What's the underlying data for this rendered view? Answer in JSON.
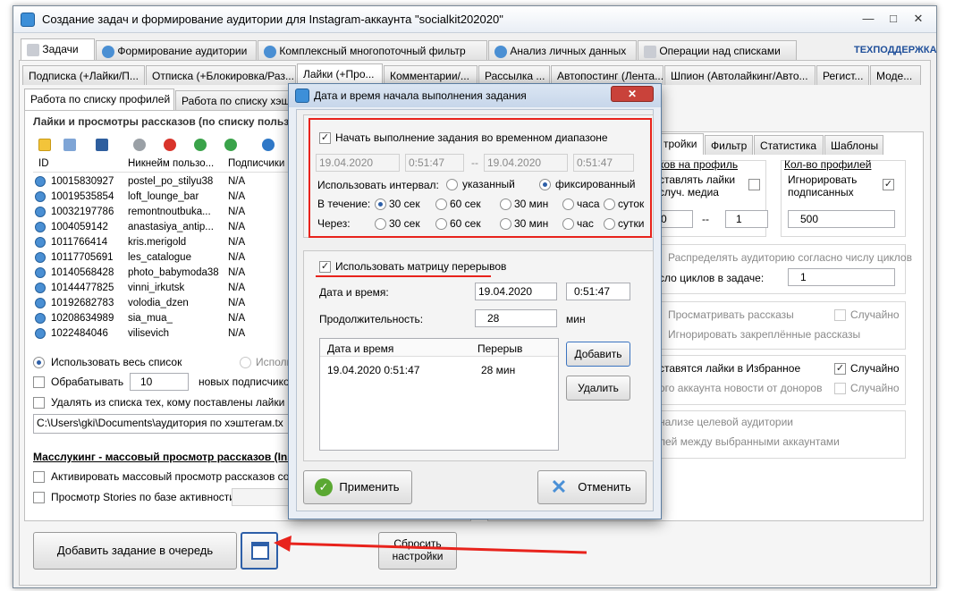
{
  "window": {
    "title": "Создание задач и формирование аудитории для Instagram-аккаунта \"socialkit202020\"",
    "controls": [
      "—",
      "□",
      "✕"
    ]
  },
  "main_tabs": [
    "Задачи",
    "Формирование аудитории",
    "Комплексный многопоточный фильтр",
    "Анализ личных данных",
    "Операции над списками"
  ],
  "support_link": "ТЕХПОДДЕРЖКА",
  "sub_tabs": [
    "Подписка (+Лайки/П...",
    "Отписка (+Блокировка/Раз...",
    "Лайки (+Про...",
    "Комментарии/...",
    "Рассылка ...",
    "Автопостинг (Лента...",
    "Шпион (Автолайкинг/Авто...",
    "Регист...",
    "Моде..."
  ],
  "list_tabs": [
    "Работа по списку профилей",
    "Работа по списку хэштегов"
  ],
  "left": {
    "section_title": "Лайки и просмотры рассказов (по списку пользователей)",
    "columns": [
      "ID",
      "Никнейм пользо...",
      "Подписчики"
    ],
    "rows": [
      [
        "10015830927",
        "postel_po_stilyu38",
        "N/A"
      ],
      [
        "10019535854",
        "loft_lounge_bar",
        "N/A"
      ],
      [
        "10032197786",
        "remontnoutbuka...",
        "N/A"
      ],
      [
        "1004059142",
        "anastasiya_antip...",
        "N/A"
      ],
      [
        "1011766414",
        "kris.merigold",
        "N/A"
      ],
      [
        "10117705691",
        "les_catalogue",
        "N/A"
      ],
      [
        "10140568428",
        "photo_babymoda38",
        "N/A"
      ],
      [
        "10144477825",
        "vinni_irkutsk",
        "N/A"
      ],
      [
        "10192682783",
        "volodia_dzen",
        "N/A"
      ],
      [
        "10208634989",
        "sia_mua_",
        "N/A"
      ],
      [
        "1022484046",
        "vilisevich",
        "N/A"
      ]
    ],
    "use_whole_list": "Использовать весь список",
    "use_partial": "Исполь",
    "process_label": "Обрабатывать",
    "process_value": "10",
    "process_suffix": "новых подписчиков ка",
    "delete_label": "Удалять из списка тех, кому поставлены лайки",
    "path": "C:\\Users\\gki\\Documents\\аудитория по хэштегам.tx",
    "mass_title": "Масслукинг - массовый просмотр рассказов (Ins",
    "mass_activate": "Активировать массовый просмотр рассказов со сбор",
    "stories_label": "Просмотр Stories по базе активности:",
    "add_task_button": "Добавить задание в очередь",
    "reset_button": "Сбросить настройки"
  },
  "right": {
    "tabs": [
      "тройки",
      "Фильтр",
      "Статистика",
      "Шаблоны"
    ],
    "likes_on_profile": "ков на профиль",
    "profile_count": "Кол-во профилей",
    "put_likes": "ставлять лайки",
    "random_media": "случ. медиа",
    "ignore_label": "Игнорировать",
    "ignore_label2": "подписанных",
    "range_from": "0",
    "range_sep": "--",
    "range_to": "1",
    "count_value": "500",
    "distribute": "Распределять аудиторию согласно числу циклов",
    "cycles_label": "сло циклов в задаче:",
    "cycles_value": "1",
    "view_stories": "Просматривать рассказы",
    "random1": "Случайно",
    "ignore_pinned": "Игнорировать закреплённые рассказы",
    "favorites": "ставятся лайки в Избранное",
    "random2": "Случайно",
    "donor_news": "ого аккаунта новости от доноров",
    "random3": "Случайно",
    "analyze": "нализе целевой аудитории",
    "between": "лей между выбранными аккаунтами"
  },
  "dialog": {
    "title": "Дата и время начала выполнения задания",
    "start_in_range": "Начать выполнение задания во временном диапазоне",
    "date_from": "19.04.2020",
    "time_from": "0:51:47",
    "range_dash": "--",
    "date_to": "19.04.2020",
    "time_to": "0:51:47",
    "use_interval": "Использовать интервал:",
    "opt_specified": "указанный",
    "opt_fixed": "фиксированный",
    "during_label": "В течение:",
    "after_label": "Через:",
    "during_opts": [
      "30 сек",
      "60 сек",
      "30 мин",
      "часа",
      "суток"
    ],
    "after_opts": [
      "30 сек",
      "60 сек",
      "30 мин",
      "час",
      "сутки"
    ],
    "use_matrix": "Использовать матрицу перерывов",
    "datetime_label": "Дата и время:",
    "date": "19.04.2020",
    "time": "0:51:47",
    "duration_label": "Продолжительность:",
    "duration": "28",
    "duration_unit": "мин",
    "table_cols": [
      "Дата и время",
      "Перерыв"
    ],
    "table_row": [
      "19.04.2020 0:51:47",
      "28 мин"
    ],
    "add_button": "Добавить",
    "delete_button": "Удалить",
    "apply_button": "Применить",
    "cancel_button": "Отменить"
  },
  "colors": {
    "highlight": "#e8231c",
    "accent": "#2d5fa8"
  }
}
